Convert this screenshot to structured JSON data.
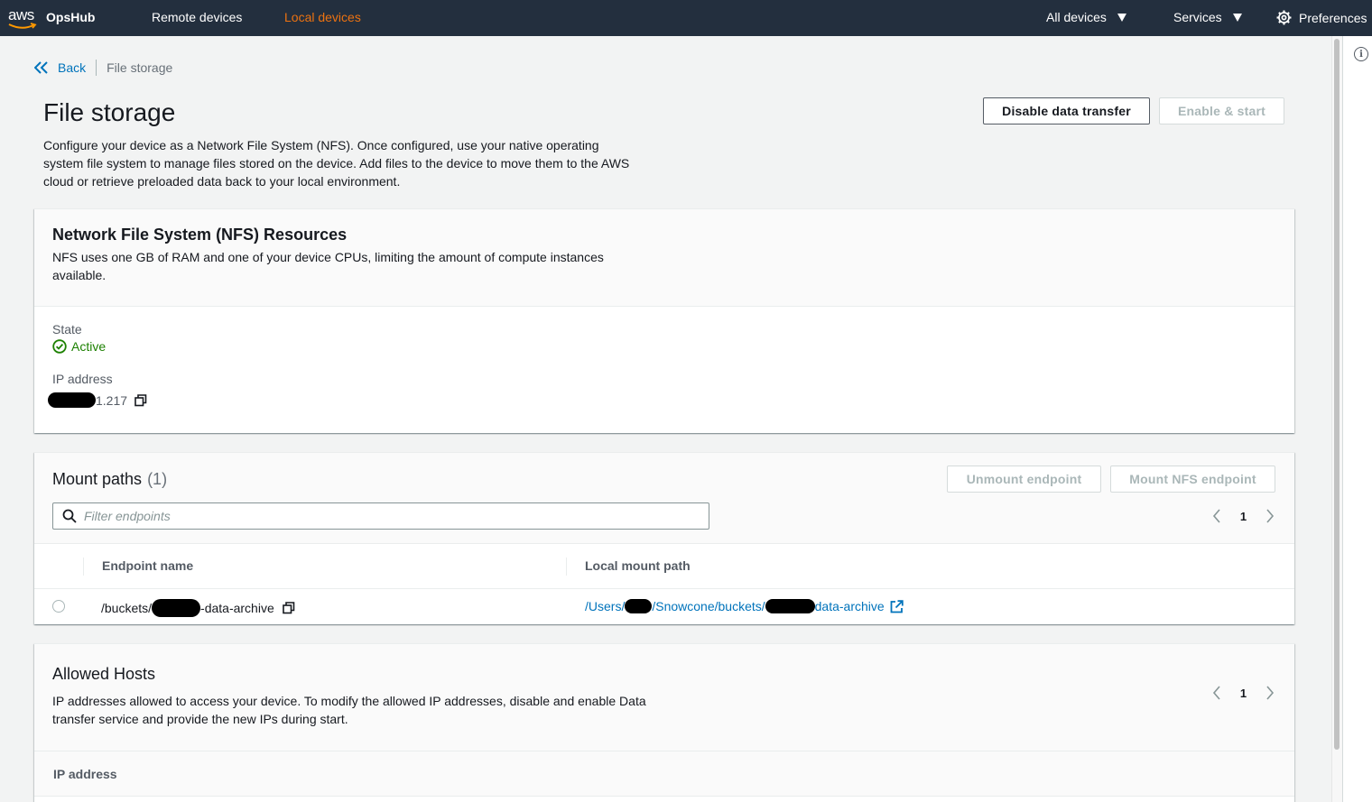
{
  "topnav": {
    "logo_text": "aws",
    "app_name": "OpsHub",
    "remote_devices": "Remote devices",
    "local_devices": "Local devices",
    "all_devices": "All devices",
    "services": "Services",
    "preferences": "Preferences"
  },
  "breadcrumb": {
    "back": "Back",
    "current": "File storage"
  },
  "page": {
    "title": "File storage",
    "description": "Configure your device as a Network File System (NFS). Once configured, use your native operating system file system to manage files stored on the device. Add files to the device to move them to the AWS cloud or retrieve preloaded data back to your local environment.",
    "disable_button": "Disable data transfer",
    "enable_button": "Enable & start"
  },
  "nfs": {
    "title": "Network File System (NFS) Resources",
    "description": "NFS uses one GB of RAM and one of your device CPUs, limiting the amount of compute instances available.",
    "state_label": "State",
    "state_value": "Active",
    "ip_label": "IP address",
    "ip_suffix": "1.217"
  },
  "mount": {
    "title": "Mount paths",
    "count": "(1)",
    "unmount_button": "Unmount endpoint",
    "mount_button": "Mount NFS endpoint",
    "filter_placeholder": "Filter endpoints",
    "page": "1",
    "columns": [
      "Endpoint name",
      "Local mount path"
    ],
    "rows": [
      {
        "endpoint_prefix": "/buckets/",
        "endpoint_suffix": "-data-archive",
        "path_prefix": "/Users/",
        "path_mid": "/Snowcone/buckets/",
        "path_suffix": "data-archive"
      }
    ]
  },
  "hosts": {
    "title": "Allowed Hosts",
    "description": "IP addresses allowed to access your device. To modify the allowed IP addresses, disable and enable Data transfer service and provide the new IPs during start.",
    "page": "1",
    "column": "IP address"
  },
  "colors": {
    "nav_bg": "#232f3e",
    "accent": "#ec7211",
    "link": "#0073bb",
    "success": "#1d8102"
  }
}
